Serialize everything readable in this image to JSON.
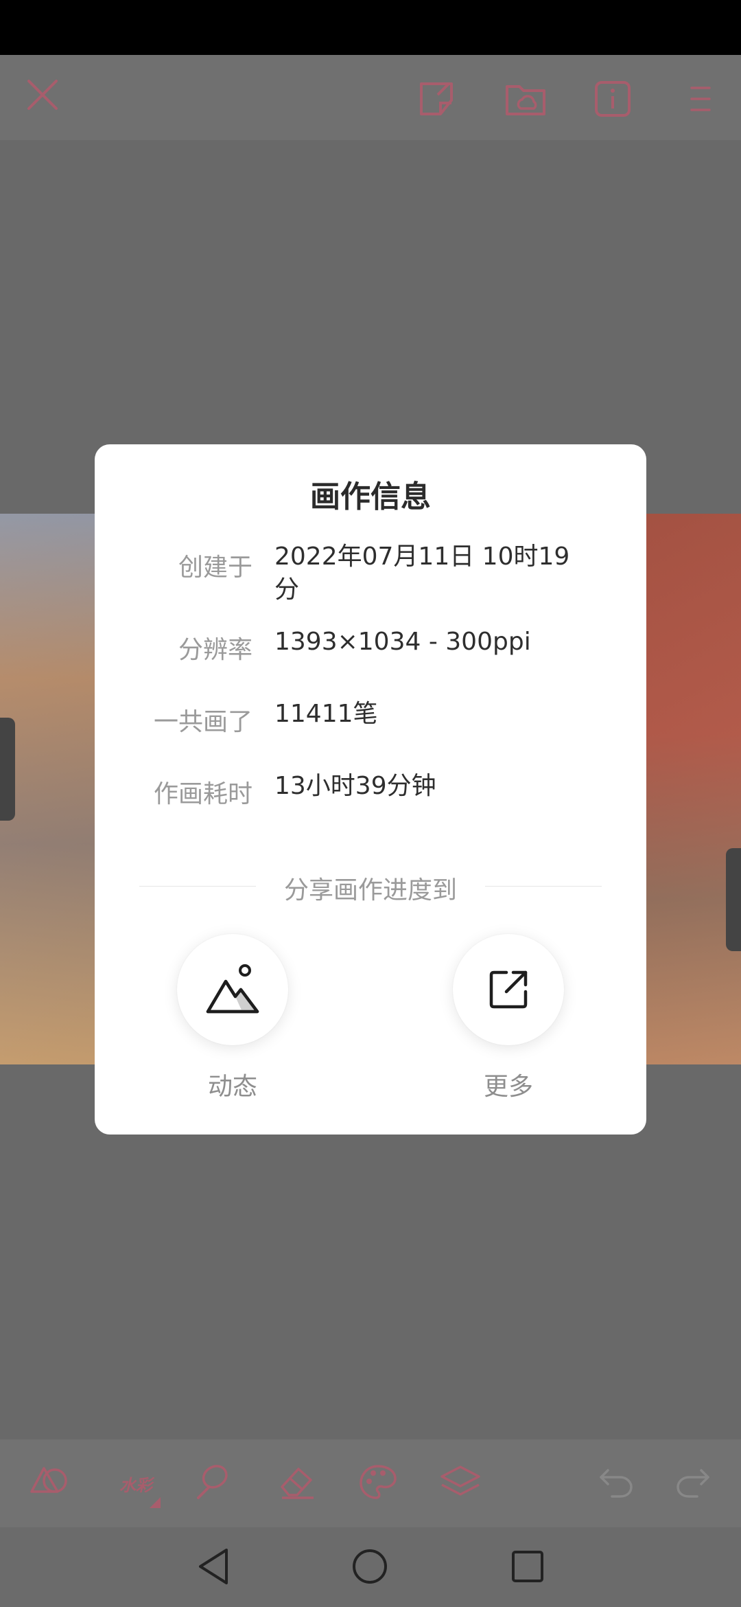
{
  "dialog": {
    "title": "画作信息",
    "rows": [
      {
        "label": "创建于",
        "value": "2022年07月11日 10时19分"
      },
      {
        "label": "分辨率",
        "value": "1393×1034 - 300ppi"
      },
      {
        "label": "一共画了",
        "value": "11411笔"
      },
      {
        "label": "作画耗时",
        "value": "13小时39分钟"
      }
    ],
    "share_title": "分享画作进度到",
    "share_options": [
      {
        "label": "动态",
        "icon": "mountain-image-icon"
      },
      {
        "label": "更多",
        "icon": "external-link-icon"
      }
    ]
  },
  "toolbar": {
    "top_icons": [
      "close-icon",
      "sticky-note-icon",
      "cloud-folder-icon",
      "info-icon",
      "menu-icon"
    ],
    "brush_label": "水彩",
    "bottom_icons": [
      "shapes-icon",
      "brush-icon",
      "smudge-icon",
      "eraser-icon",
      "palette-icon",
      "layers-icon",
      "undo-icon",
      "redo-icon"
    ]
  },
  "nav": {
    "icons": [
      "back-icon",
      "home-icon",
      "recents-icon"
    ]
  },
  "colors": {
    "accent_dimmed": "#a85d6c",
    "overlay": "#6b6b6b",
    "dialog_bg": "#ffffff"
  }
}
